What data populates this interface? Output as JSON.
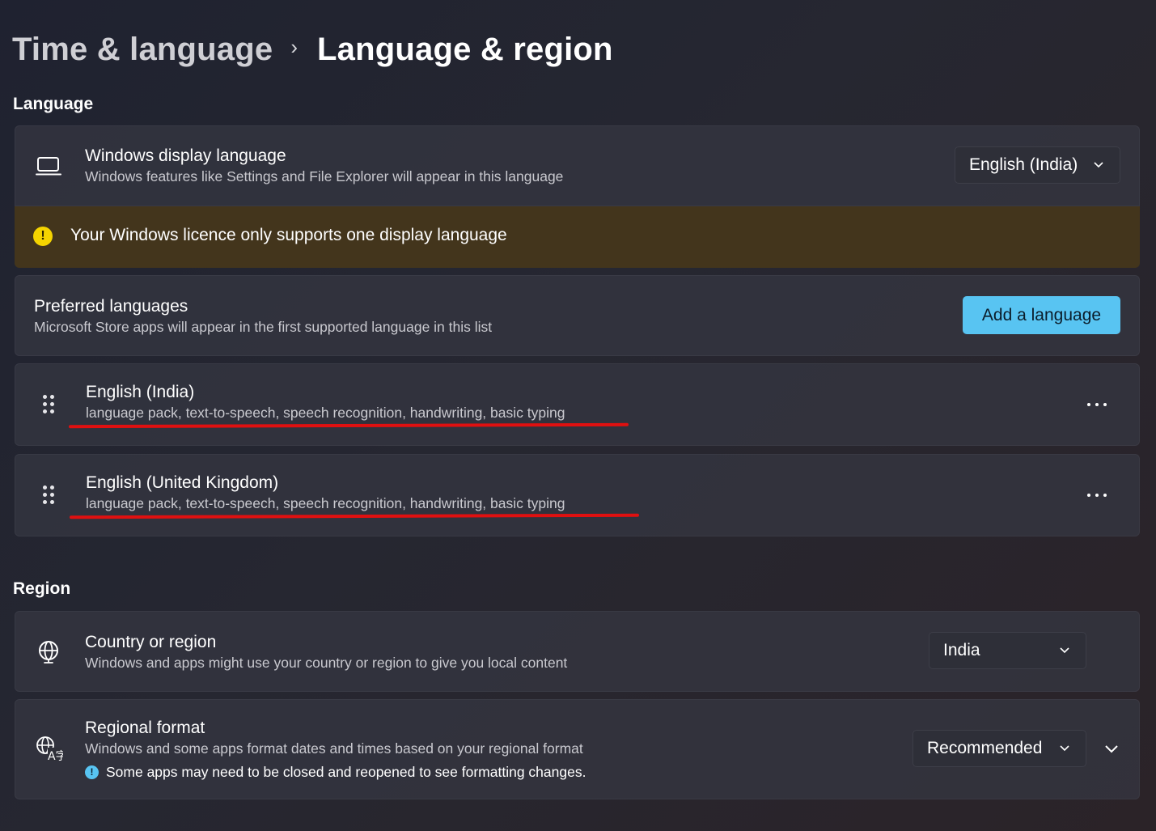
{
  "breadcrumb": {
    "parent": "Time & language",
    "separator": "›",
    "current": "Language & region"
  },
  "language_section": {
    "title": "Language",
    "display_language": {
      "icon": "laptop-icon",
      "title": "Windows display language",
      "subtitle": "Windows features like Settings and File Explorer will appear in this language",
      "selected": "English (India)"
    },
    "warning": {
      "icon": "warning-icon",
      "text": "Your Windows licence only supports one display language"
    },
    "preferred": {
      "title": "Preferred languages",
      "subtitle": "Microsoft Store apps will appear in the first supported language in this list",
      "add_button": "Add a language"
    },
    "languages": [
      {
        "name": "English (India)",
        "features": "language pack, text-to-speech, speech recognition, handwriting, basic typing"
      },
      {
        "name": "English (United Kingdom)",
        "features": "language pack, text-to-speech, speech recognition, handwriting, basic typing"
      }
    ]
  },
  "region_section": {
    "title": "Region",
    "country": {
      "icon": "globe-icon",
      "title": "Country or region",
      "subtitle": "Windows and apps might use your country or region to give you local content",
      "selected": "India"
    },
    "format": {
      "icon": "regional-format-icon",
      "title": "Regional format",
      "subtitle": "Windows and some apps format dates and times based on your regional format",
      "note": "Some apps may need to be closed and reopened to see formatting changes.",
      "selected": "Recommended"
    }
  },
  "colors": {
    "accent": "#58c4f2",
    "warning_band": "#43351c",
    "warning_icon": "#f5d400",
    "annotation_underline": "#e01010"
  }
}
